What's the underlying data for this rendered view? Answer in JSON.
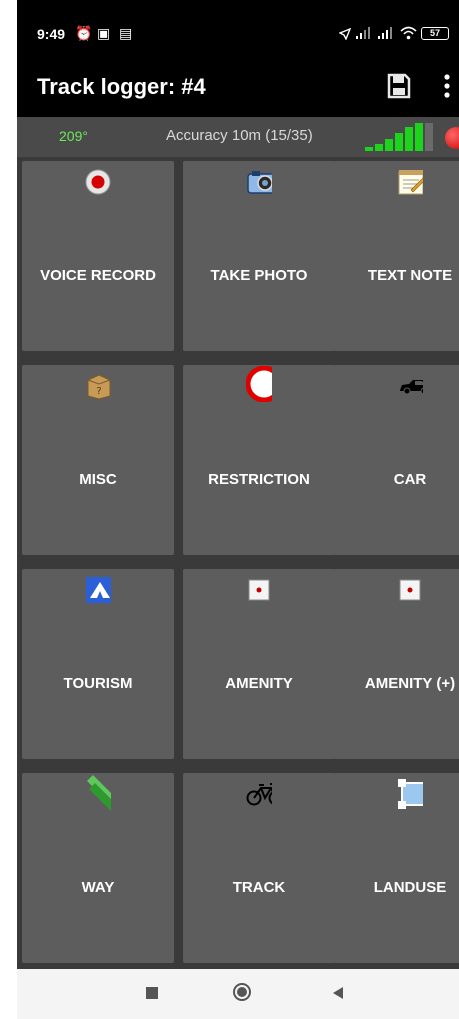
{
  "status_bar": {
    "time": "9:49",
    "battery": "57"
  },
  "toolbar": {
    "title": "Track logger: #4"
  },
  "info": {
    "heading": "209°",
    "accuracy": "Accuracy 10m (15/35)"
  },
  "tiles": [
    {
      "label": "VOICE RECORD",
      "icon": "record-icon"
    },
    {
      "label": "TAKE PHOTO",
      "icon": "camera-icon"
    },
    {
      "label": "TEXT NOTE",
      "icon": "notepad-icon"
    },
    {
      "label": "MISC",
      "icon": "box-icon"
    },
    {
      "label": "RESTRICTION",
      "icon": "restriction-sign-icon"
    },
    {
      "label": "CAR",
      "icon": "car-icon"
    },
    {
      "label": "TOURISM",
      "icon": "tent-icon"
    },
    {
      "label": "AMENITY",
      "icon": "amenity-dot-icon"
    },
    {
      "label": "AMENITY (+)",
      "icon": "amenity-dot-icon"
    },
    {
      "label": "WAY",
      "icon": "way-icon"
    },
    {
      "label": "TRACK",
      "icon": "bicycle-icon"
    },
    {
      "label": "LANDUSE",
      "icon": "landuse-icon"
    }
  ],
  "colors": {
    "heading": "#6ee85c",
    "tile": "#5d5d5d",
    "background": "#3a3a3a"
  }
}
